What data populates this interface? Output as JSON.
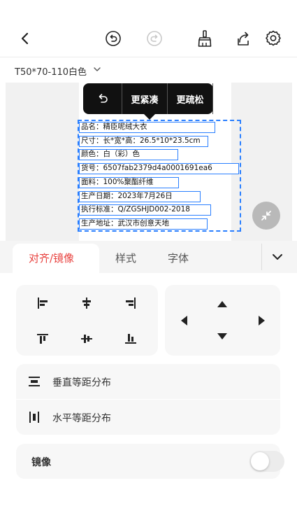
{
  "toolbar": {
    "back_icon": "chevron-left-icon",
    "undo_icon": "undo-icon",
    "redo_icon": "redo-icon",
    "clear_icon": "broom-icon",
    "share_icon": "share-icon",
    "settings_icon": "gear-icon"
  },
  "template": {
    "name": "T50*70-110白色"
  },
  "popmenu": {
    "undo_icon": "undo-icon",
    "tighter": "更紧凑",
    "looser": "更疏松"
  },
  "label_fields": [
    "品名：精臣呢绒大衣",
    "尺寸：长*宽*高：26.5*10*23.5cm",
    "颜色：白（彩）色",
    "货号：6507fab2379d4a0001691ea6",
    "面料：100%聚酯纤维",
    "生产日期：2023年7月26日",
    "执行标准：Q/ZGSHJD002-2018",
    "生产地址：武汉市创意天地"
  ],
  "tabs": [
    {
      "label": "对齐/镜像",
      "active": true
    },
    {
      "label": "样式",
      "active": false
    },
    {
      "label": "字体",
      "active": false
    }
  ],
  "distribute": {
    "vertical": "垂直等距分布",
    "horizontal": "水平等距分布"
  },
  "mirror": {
    "label": "镜像",
    "enabled": false
  },
  "colors": {
    "accent": "#e8423f",
    "selection": "#2a7fff",
    "menu_bg": "#111111"
  }
}
